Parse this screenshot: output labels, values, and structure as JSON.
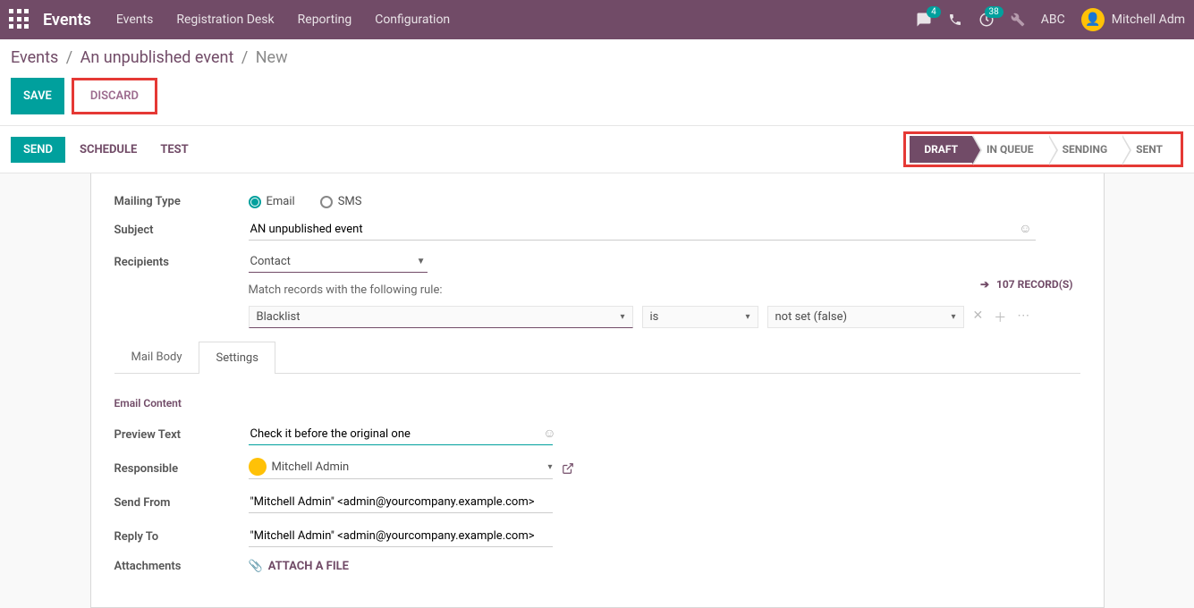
{
  "topbar": {
    "brand": "Events",
    "nav": [
      "Events",
      "Registration Desk",
      "Reporting",
      "Configuration"
    ],
    "msg_badge": "4",
    "clock_badge": "38",
    "company": "ABC",
    "username": "Mitchell Adm"
  },
  "breadcrumb": {
    "root": "Events",
    "parent": "An unpublished event",
    "current": "New"
  },
  "action": {
    "save": "SAVE",
    "discard": "DISCARD"
  },
  "statusbar": {
    "send": "SEND",
    "schedule": "SCHEDULE",
    "test": "TEST",
    "stages": [
      "DRAFT",
      "IN QUEUE",
      "SENDING",
      "SENT"
    ],
    "active_stage": 0
  },
  "form": {
    "mailing_type_label": "Mailing Type",
    "mailing_type_email": "Email",
    "mailing_type_sms": "SMS",
    "subject_label": "Subject",
    "subject_value": "AN unpublished event",
    "recipients_label": "Recipients",
    "recipients_value": "Contact",
    "match_rule_text": "Match records with the following rule:",
    "records_count": "107 RECORD(S)",
    "filter_field": "Blacklist",
    "filter_op": "is",
    "filter_val": "not set (false)"
  },
  "tabs": {
    "body": "Mail Body",
    "settings": "Settings"
  },
  "settings": {
    "section": "Email Content",
    "preview_label": "Preview Text",
    "preview_value": "Check it before the original one",
    "responsible_label": "Responsible",
    "responsible_value": "Mitchell Admin",
    "sendfrom_label": "Send From",
    "sendfrom_value": "\"Mitchell Admin\" <admin@yourcompany.example.com>",
    "replyto_label": "Reply To",
    "replyto_value": "\"Mitchell Admin\" <admin@yourcompany.example.com>",
    "attachments_label": "Attachments",
    "attach_link": "ATTACH A FILE"
  }
}
